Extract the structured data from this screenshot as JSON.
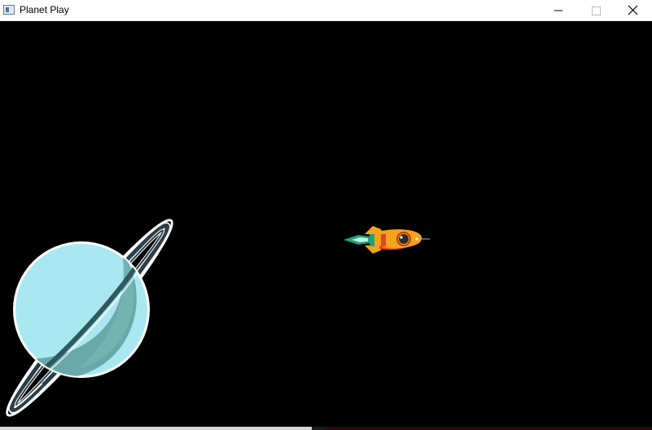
{
  "window": {
    "title": "Planet Play",
    "controls": {
      "minimize": "minimize-icon",
      "maximize": "maximize-icon",
      "close": "close-icon"
    }
  },
  "scene": {
    "background": "#000000",
    "planet": {
      "name": "ringed-planet",
      "body_color": "#a8e6ee",
      "shade_color": "#6aa5a8",
      "ring_color": "#ffffff"
    },
    "rocket": {
      "name": "rocket-ship",
      "body_color": "#f5a31a",
      "fin_color": "#e0422c",
      "flame_color": "#1fa07a"
    }
  }
}
